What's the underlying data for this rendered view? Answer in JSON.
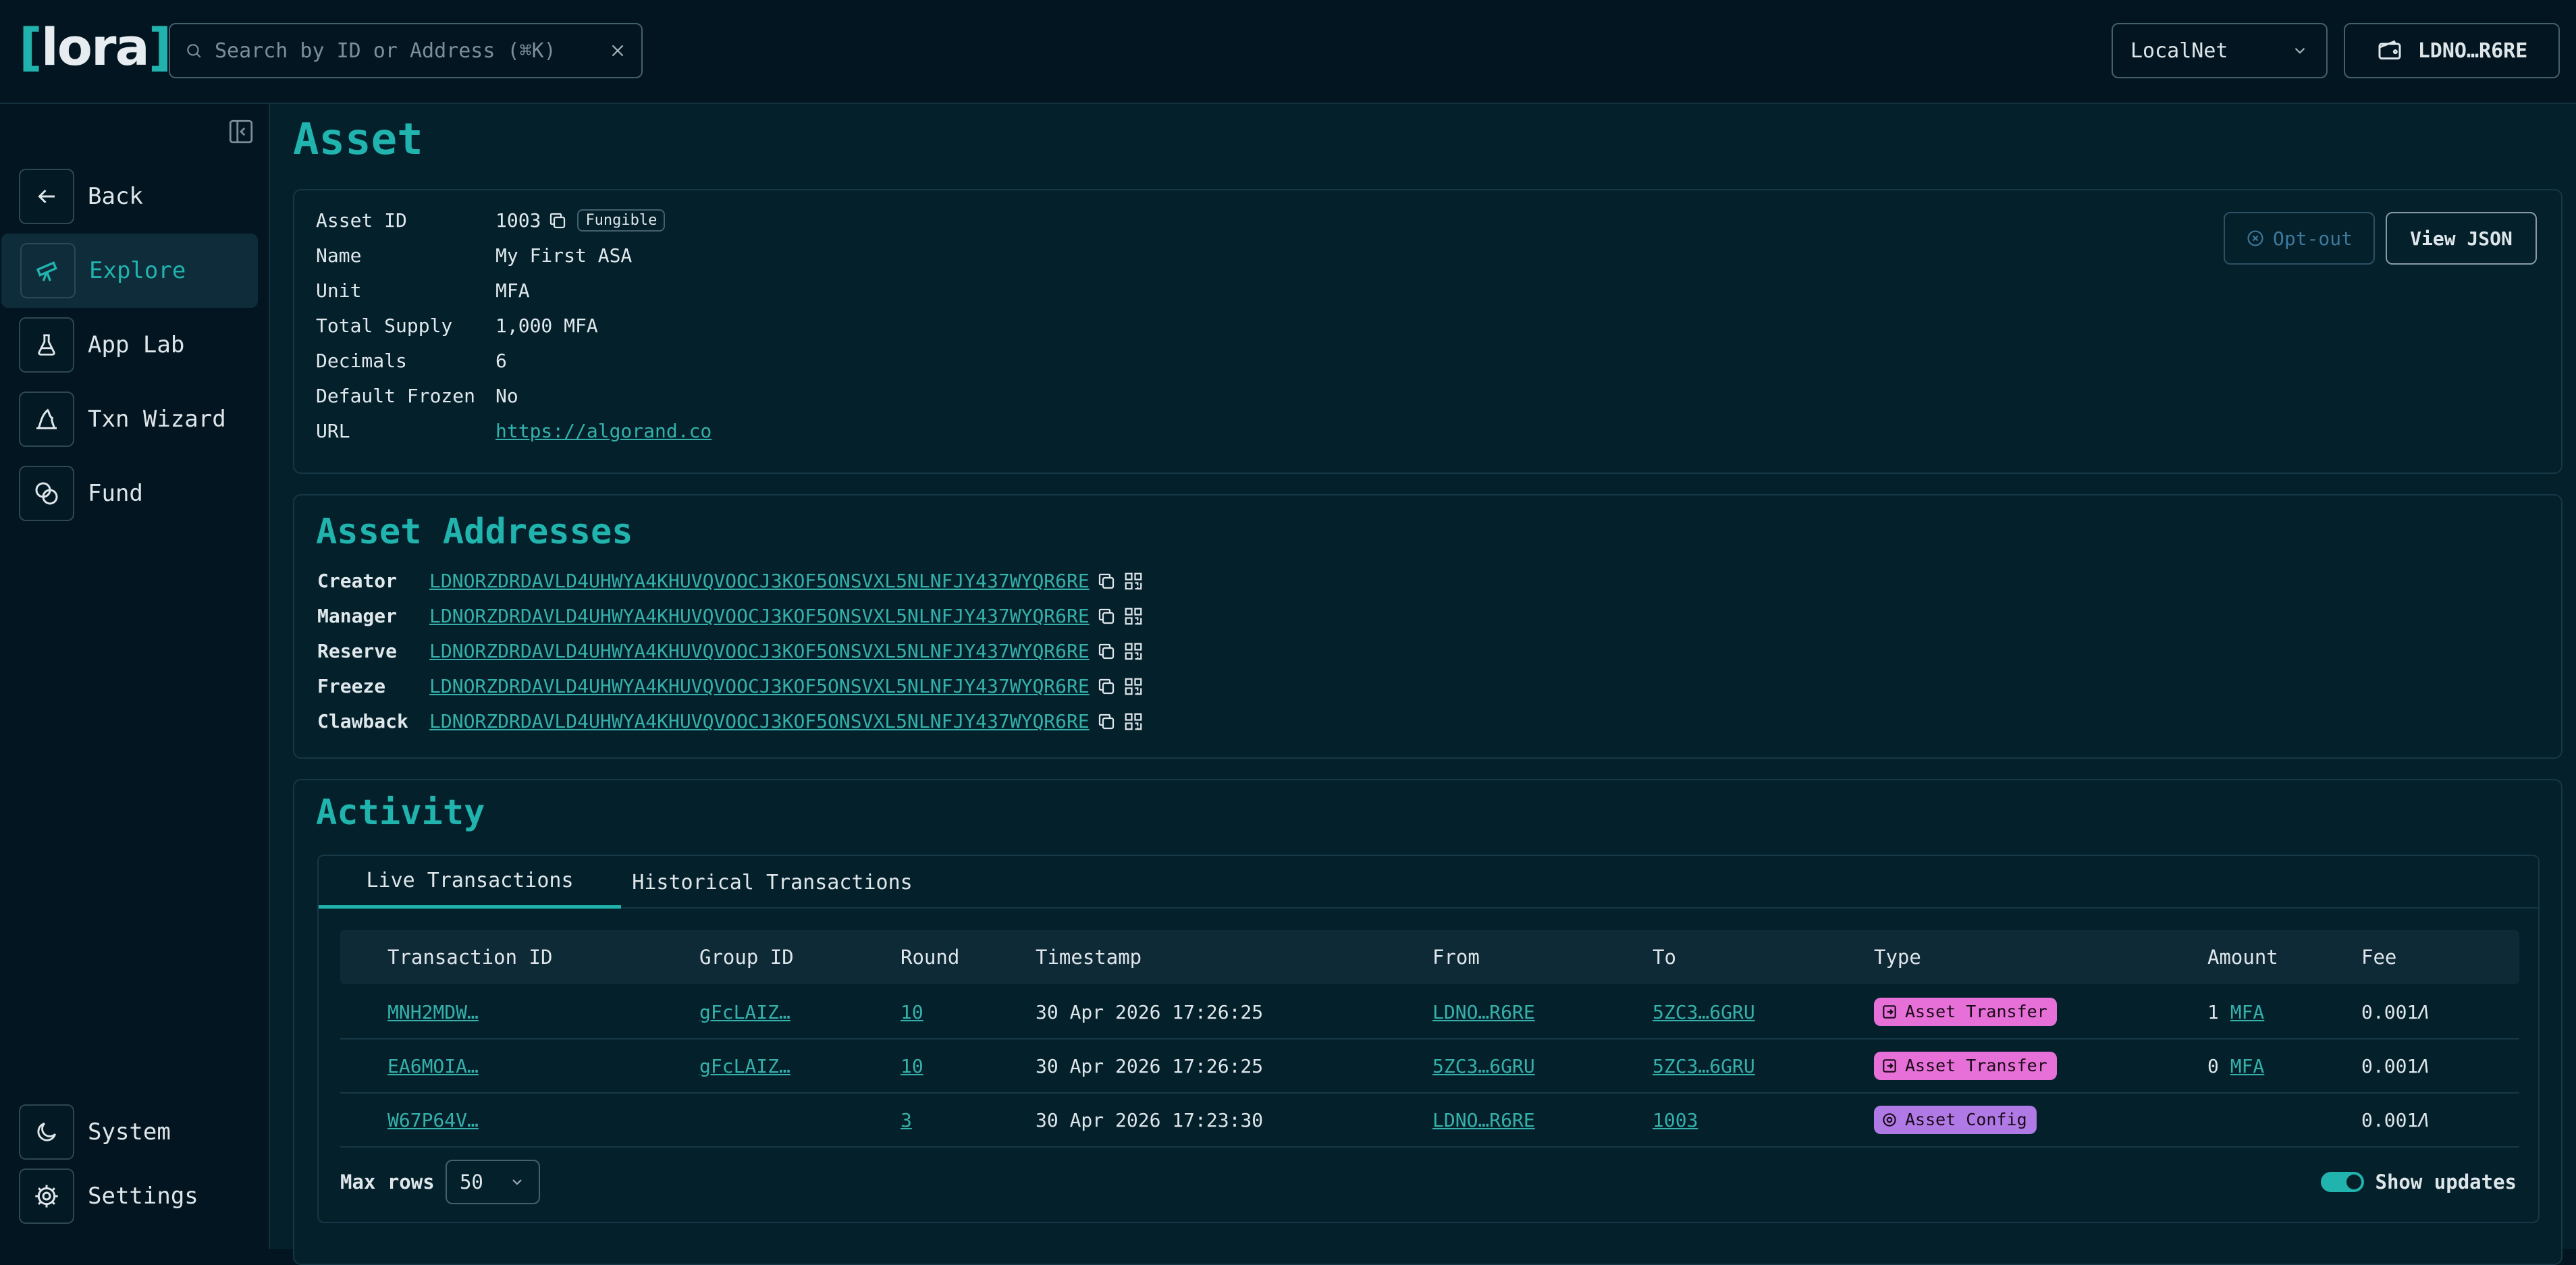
{
  "header": {
    "logo": "[lora]",
    "search_placeholder": "Search by ID or Address (⌘K)",
    "network": "LocalNet",
    "wallet": "LDNO…R6RE"
  },
  "sidebar": {
    "items": [
      {
        "label": "Back",
        "icon": "arrow-left-icon"
      },
      {
        "label": "Explore",
        "icon": "telescope-icon"
      },
      {
        "label": "App Lab",
        "icon": "flask-icon"
      },
      {
        "label": "Txn Wizard",
        "icon": "wizard-hat-icon"
      },
      {
        "label": "Fund",
        "icon": "coins-icon"
      }
    ],
    "bottom": [
      {
        "label": "System",
        "icon": "moon-icon"
      },
      {
        "label": "Settings",
        "icon": "gear-icon"
      }
    ]
  },
  "page": {
    "title": "Asset"
  },
  "asset": {
    "id_label": "Asset ID",
    "id": "1003",
    "badge": "Fungible",
    "name_label": "Name",
    "name": "My First ASA",
    "unit_label": "Unit",
    "unit": "MFA",
    "supply_label": "Total Supply",
    "supply": "1,000 MFA",
    "decimals_label": "Decimals",
    "decimals": "6",
    "frozen_label": "Default Frozen",
    "frozen": "No",
    "url_label": "URL",
    "url": "https://algorand.co",
    "optout": "Opt-out",
    "view_json": "View JSON"
  },
  "addresses": {
    "title": "Asset Addresses",
    "rows": [
      {
        "label": "Creator",
        "value": "LDNORZDRDAVLD4UHWYA4KHUVQVOOCJ3KOF5ONSVXL5NLNFJY437WYQR6RE"
      },
      {
        "label": "Manager",
        "value": "LDNORZDRDAVLD4UHWYA4KHUVQVOOCJ3KOF5ONSVXL5NLNFJY437WYQR6RE"
      },
      {
        "label": "Reserve",
        "value": "LDNORZDRDAVLD4UHWYA4KHUVQVOOCJ3KOF5ONSVXL5NLNFJY437WYQR6RE"
      },
      {
        "label": "Freeze",
        "value": "LDNORZDRDAVLD4UHWYA4KHUVQVOOCJ3KOF5ONSVXL5NLNFJY437WYQR6RE"
      },
      {
        "label": "Clawback",
        "value": "LDNORZDRDAVLD4UHWYA4KHUVQVOOCJ3KOF5ONSVXL5NLNFJY437WYQR6RE"
      }
    ]
  },
  "activity": {
    "title": "Activity",
    "tabs": [
      "Live Transactions",
      "Historical Transactions"
    ],
    "columns": [
      "Transaction ID",
      "Group ID",
      "Round",
      "Timestamp",
      "From",
      "To",
      "Type",
      "Amount",
      "Fee"
    ],
    "rows": [
      {
        "txid": "MNH2MDW…",
        "group": "gFcLAIZ…",
        "round": "10",
        "ts": "30 Apr 2026 17:26:25",
        "from": "LDNO…R6RE",
        "to": "5ZC3…6GRU",
        "type": "Asset Transfer",
        "amount": "1",
        "amount_unit": "MFA",
        "fee": "0.001"
      },
      {
        "txid": "EA6MOIA…",
        "group": "gFcLAIZ…",
        "round": "10",
        "ts": "30 Apr 2026 17:26:25",
        "from": "5ZC3…6GRU",
        "to": "5ZC3…6GRU",
        "type": "Asset Transfer",
        "amount": "0",
        "amount_unit": "MFA",
        "fee": "0.001"
      },
      {
        "txid": "W67P64V…",
        "group": "",
        "round": "3",
        "ts": "30 Apr 2026 17:23:30",
        "from": "LDNO…R6RE",
        "to": "1003",
        "type": "Asset Config",
        "amount": "",
        "amount_unit": "",
        "fee": "0.001"
      }
    ],
    "max_rows_label": "Max rows",
    "max_rows": "50",
    "show_updates": "Show updates",
    "algo_symbol": "Ʌ"
  },
  "colors": {
    "accent": "#21b3ad",
    "background": "#021520",
    "transfer_badge": "#e770d8",
    "config_badge": "#b07ae6"
  }
}
